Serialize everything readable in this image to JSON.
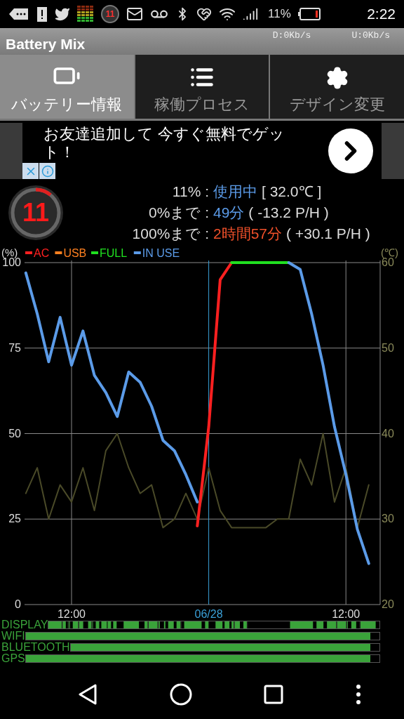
{
  "status_bar": {
    "notification_badge": "11",
    "battery_percent": "11%",
    "time": "2:22"
  },
  "app_bar": {
    "title": "Battery Mix",
    "download": "D:0Kb/s",
    "upload": "U:0Kb/s"
  },
  "tabs": [
    {
      "label": "バッテリー情報",
      "kind": "battery",
      "selected": true
    },
    {
      "label": "稼働プロセス",
      "kind": "list",
      "selected": false
    },
    {
      "label": "デザイン変更",
      "kind": "gear",
      "selected": false
    }
  ],
  "ad": {
    "text": "お友達追加して 今すぐ無料でゲット！"
  },
  "info": {
    "gauge": {
      "value": "11",
      "level": 0.11
    },
    "rows": [
      {
        "label": "11% :",
        "value": "使用中",
        "color": "#5b9be8",
        "detail": "[ 32.0℃ ]"
      },
      {
        "label": "0%まで :",
        "value": "49分",
        "color": "#5b9be8",
        "detail": "( -13.2 P/H )"
      },
      {
        "label": "100%まで :",
        "value": "2時間57分",
        "color": "#f0502a",
        "detail": "( +30.1 P/H )"
      }
    ]
  },
  "chart": {
    "chart_data": {
      "type": "line",
      "ylabel": "(%)",
      "y2label": "(℃)",
      "categories": [
        null,
        null,
        null,
        null,
        "12:00",
        null,
        null,
        null,
        null,
        null,
        null,
        null,
        null,
        null,
        null,
        null,
        "06/28",
        null,
        null,
        null,
        null,
        null,
        null,
        null,
        null,
        null,
        null,
        null,
        "12:00",
        null,
        null
      ],
      "grid": true,
      "legend": "top",
      "ylim": [
        0,
        100
      ],
      "yticks": [
        0,
        25,
        50,
        75,
        100
      ],
      "y2lim": [
        20,
        60
      ],
      "y2ticks": [
        20,
        30,
        40,
        50,
        60
      ],
      "series": [
        {
          "name": "AC",
          "color": "#ff2020",
          "values": [
            null,
            null,
            null,
            null,
            null,
            null,
            null,
            null,
            null,
            null,
            null,
            null,
            null,
            null,
            null,
            23,
            52,
            95,
            100,
            null,
            null,
            null,
            null,
            null,
            null,
            null,
            null,
            null,
            null,
            null,
            null
          ]
        },
        {
          "name": "USB",
          "color": "#ff8020",
          "values": [
            null,
            null,
            null,
            null,
            null,
            null,
            null,
            null,
            null,
            null,
            null,
            null,
            null,
            null,
            null,
            null,
            null,
            null,
            null,
            null,
            null,
            null,
            null,
            null,
            null,
            null,
            null,
            null,
            null,
            null,
            null
          ]
        },
        {
          "name": "FULL",
          "color": "#20e020",
          "values": [
            null,
            null,
            null,
            null,
            null,
            null,
            null,
            null,
            null,
            null,
            null,
            null,
            null,
            null,
            null,
            null,
            null,
            null,
            100,
            100,
            100,
            100,
            100,
            100,
            null,
            null,
            null,
            null,
            null,
            null,
            null
          ]
        },
        {
          "name": "IN USE",
          "color": "#5b9be8",
          "values": [
            97,
            85,
            71,
            84,
            70,
            80,
            67,
            62,
            55,
            68,
            65,
            58,
            48,
            45,
            38,
            30,
            null,
            null,
            null,
            null,
            null,
            null,
            null,
            100,
            98,
            85,
            70,
            52,
            38,
            22,
            12
          ]
        },
        {
          "color": "#4a4a28",
          "axis": "y2",
          "values": [
            33,
            36,
            30,
            34,
            32,
            36,
            31,
            38,
            40,
            36,
            33,
            34,
            29,
            30,
            33,
            30,
            36,
            31,
            29,
            29,
            29,
            29,
            30,
            30,
            37,
            34,
            40,
            32,
            36,
            29,
            34
          ]
        }
      ]
    }
  },
  "usage_bars": [
    {
      "label": "DISPLAY",
      "kind": "pattern"
    },
    {
      "label": "WIFI",
      "kind": "fill",
      "level": 0.975
    },
    {
      "label": "BLUETOOTH",
      "kind": "fill",
      "level": 0.97
    },
    {
      "label": "GPS",
      "kind": "fill",
      "level": 0.975
    }
  ]
}
